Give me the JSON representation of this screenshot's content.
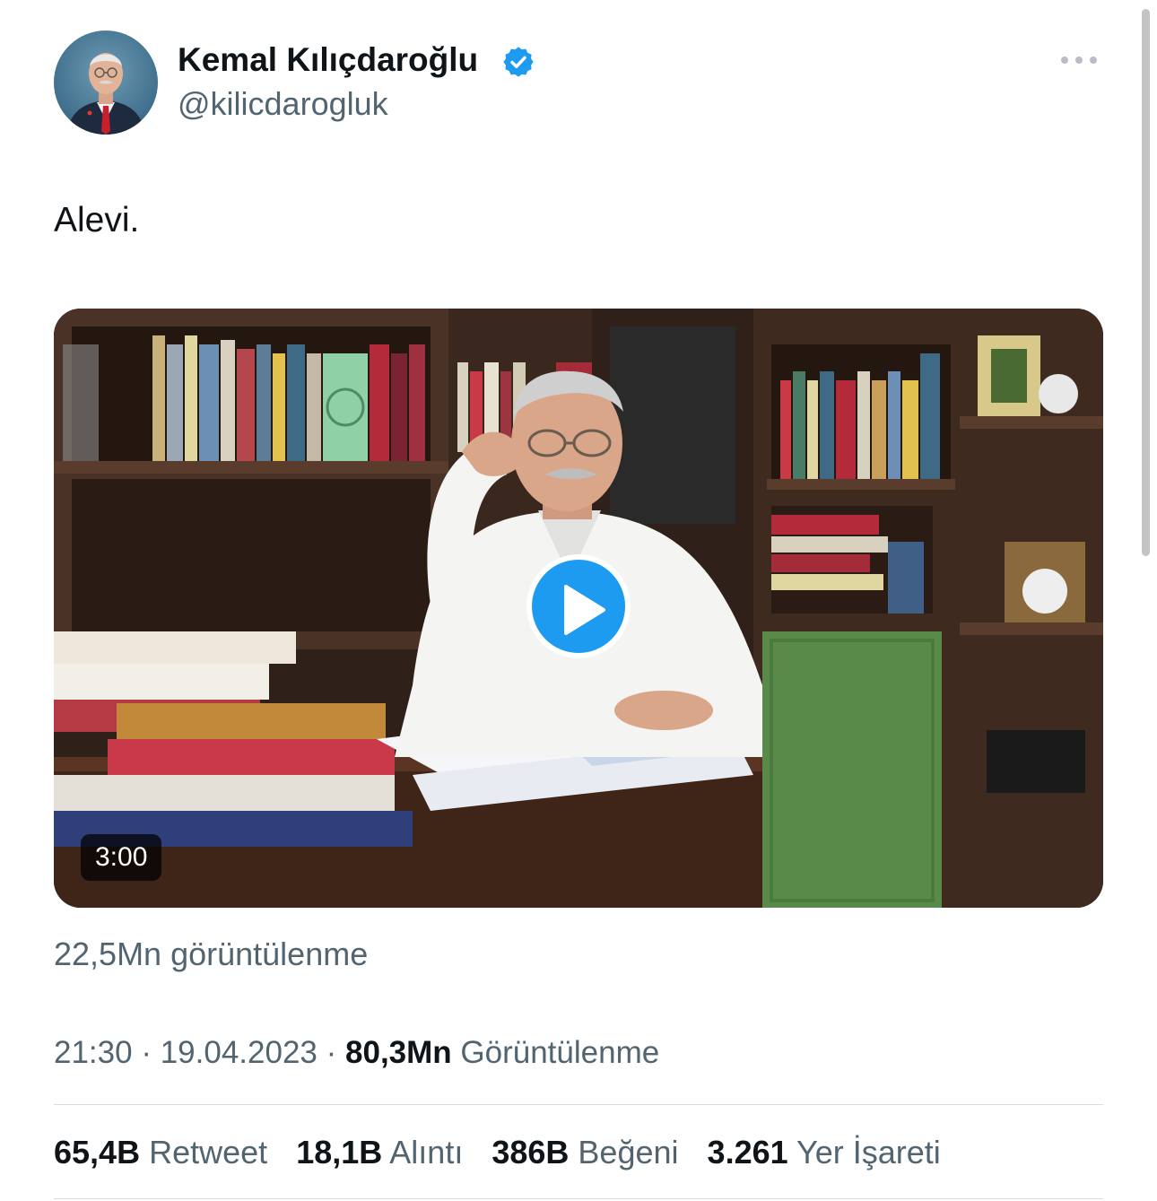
{
  "author": {
    "name": "Kemal Kılıçdaroğlu",
    "handle": "@kilicdarogluk",
    "verified_color": "#1d9bf0"
  },
  "tweet": {
    "text": "Alevi."
  },
  "media": {
    "type": "video",
    "duration": "3:00",
    "play_icon": "play-icon",
    "accent": "#1d9bf0",
    "video_views": "22,5Mn görüntülenme"
  },
  "meta": {
    "time": "21:30",
    "separator": "·",
    "date": "19.04.2023",
    "views_count": "80,3Mn",
    "views_label": "Görüntülenme"
  },
  "stats": [
    {
      "count": "65,4B",
      "label": "Retweet"
    },
    {
      "count": "18,1B",
      "label": "Alıntı"
    },
    {
      "count": "386B",
      "label": "Beğeni"
    },
    {
      "count": "3.261",
      "label": "Yer İşareti"
    }
  ],
  "colors": {
    "text_primary": "#0f1419",
    "text_secondary": "#536471",
    "divider": "#d8dde1"
  }
}
